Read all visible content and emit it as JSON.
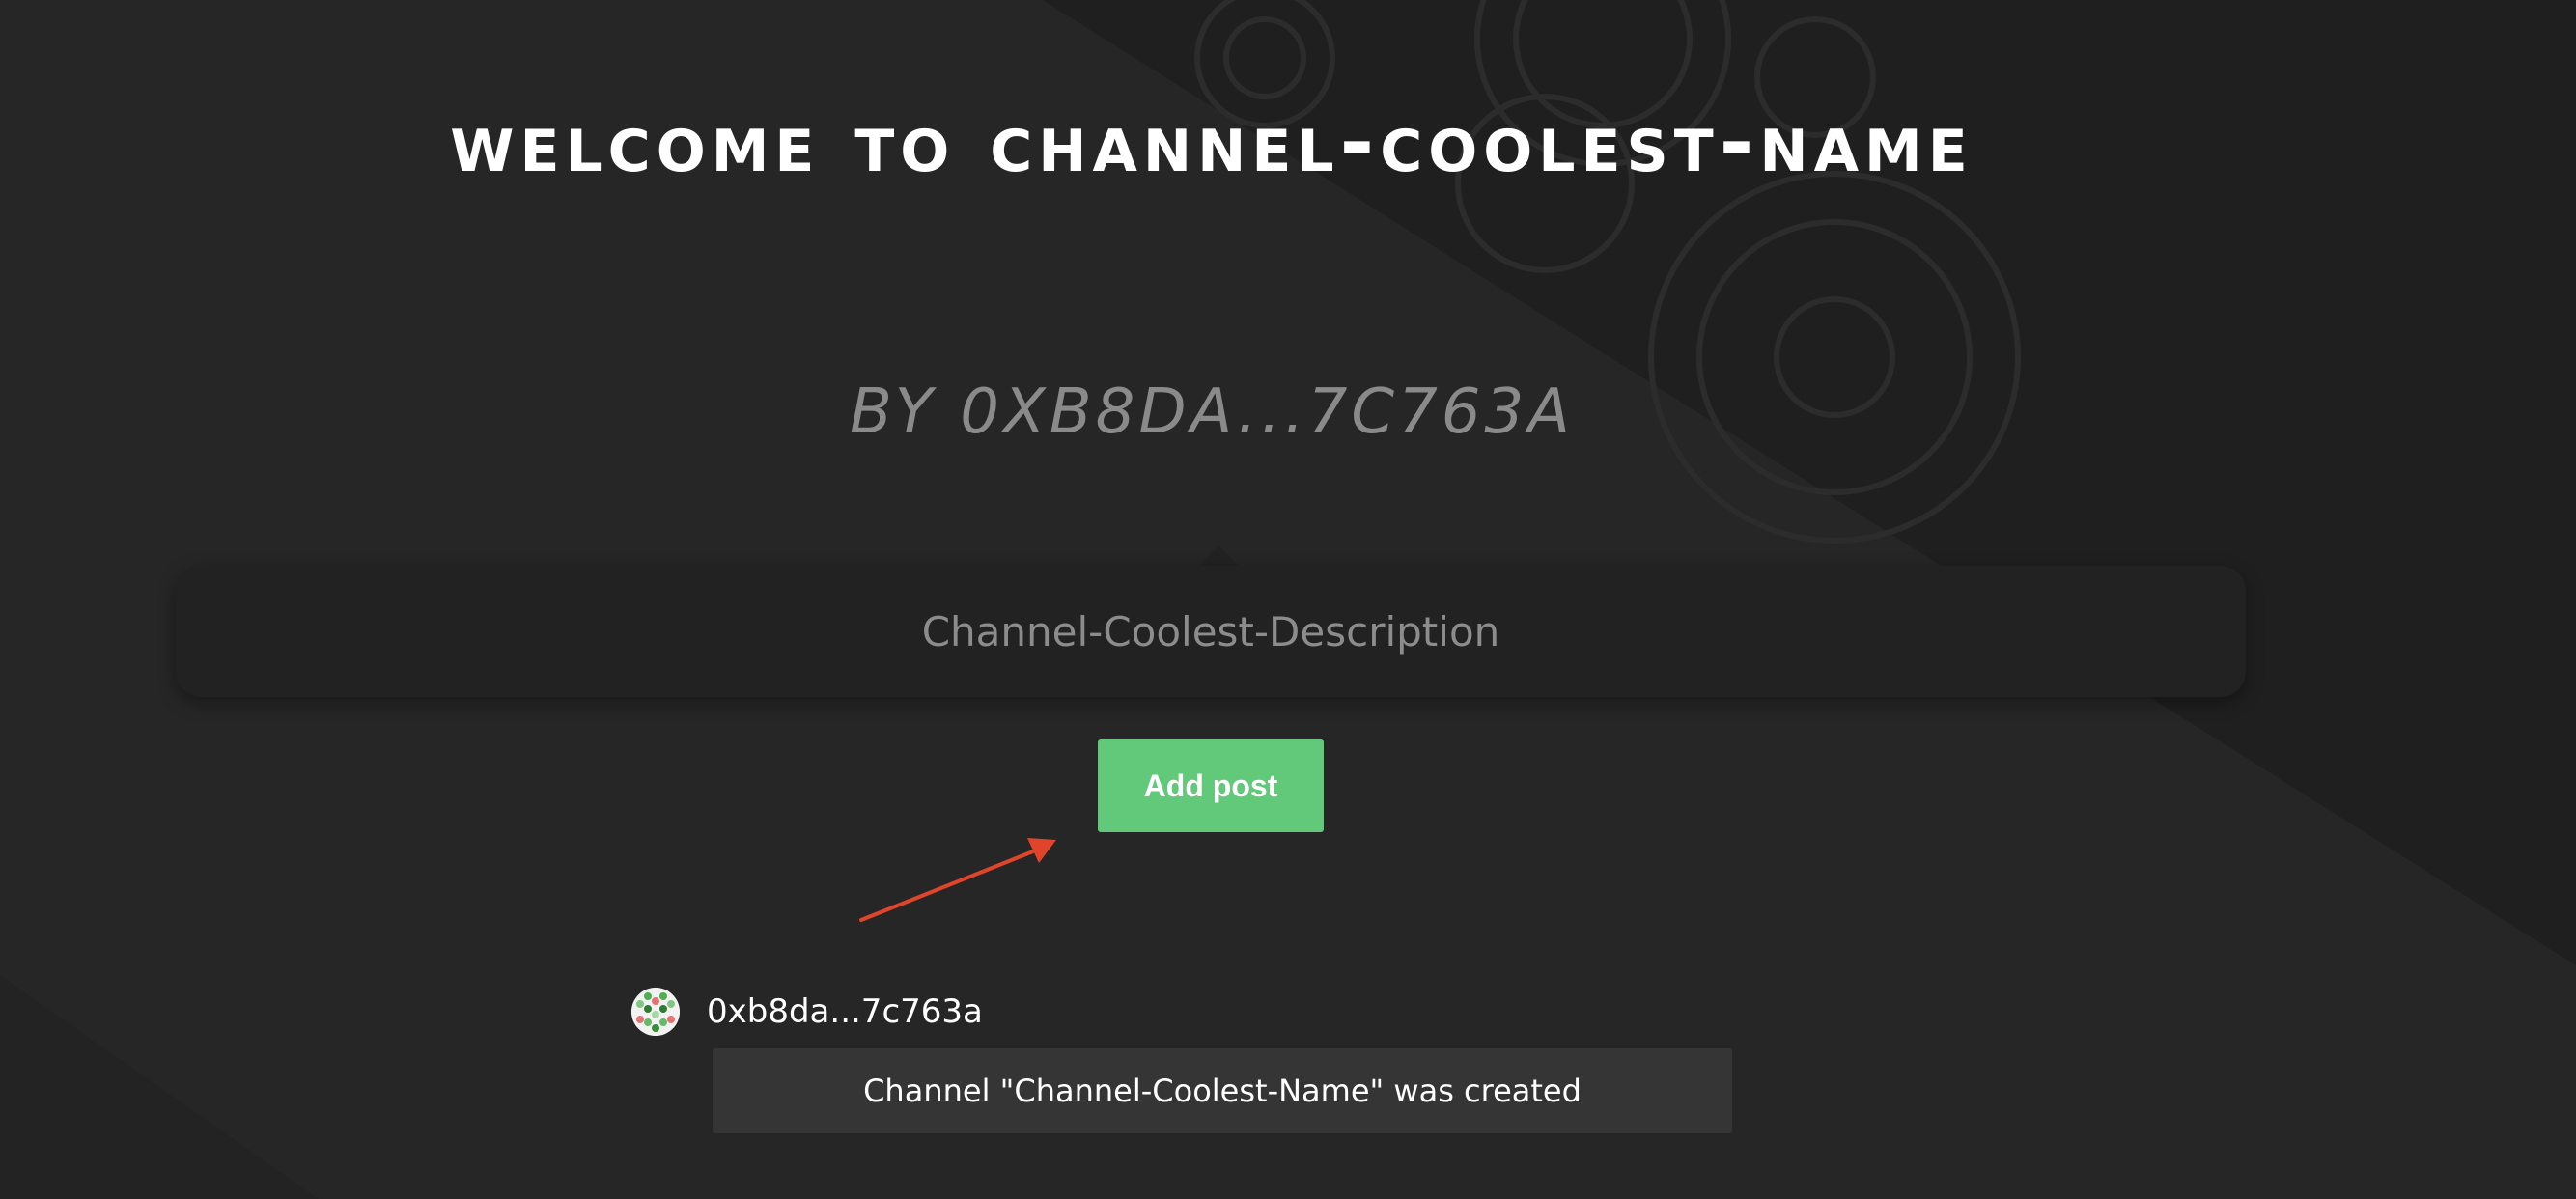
{
  "page": {
    "title": "welcome to channel-coolest-name",
    "byline": "BY 0XB8DA...7C763A",
    "description": "Channel-Coolest-Description"
  },
  "actions": {
    "add_post_label": "Add post"
  },
  "posts": [
    {
      "author": "0xb8da...7c763a",
      "message": "Channel \"Channel-Coolest-Name\" was created"
    }
  ],
  "colors": {
    "background": "#232323",
    "accent_green": "#62c97a",
    "annotation_arrow": "#e0452b",
    "post_box": "#353535"
  },
  "icons": {
    "avatar": "identicon-avatar",
    "annotation": "red-arrow-icon"
  }
}
